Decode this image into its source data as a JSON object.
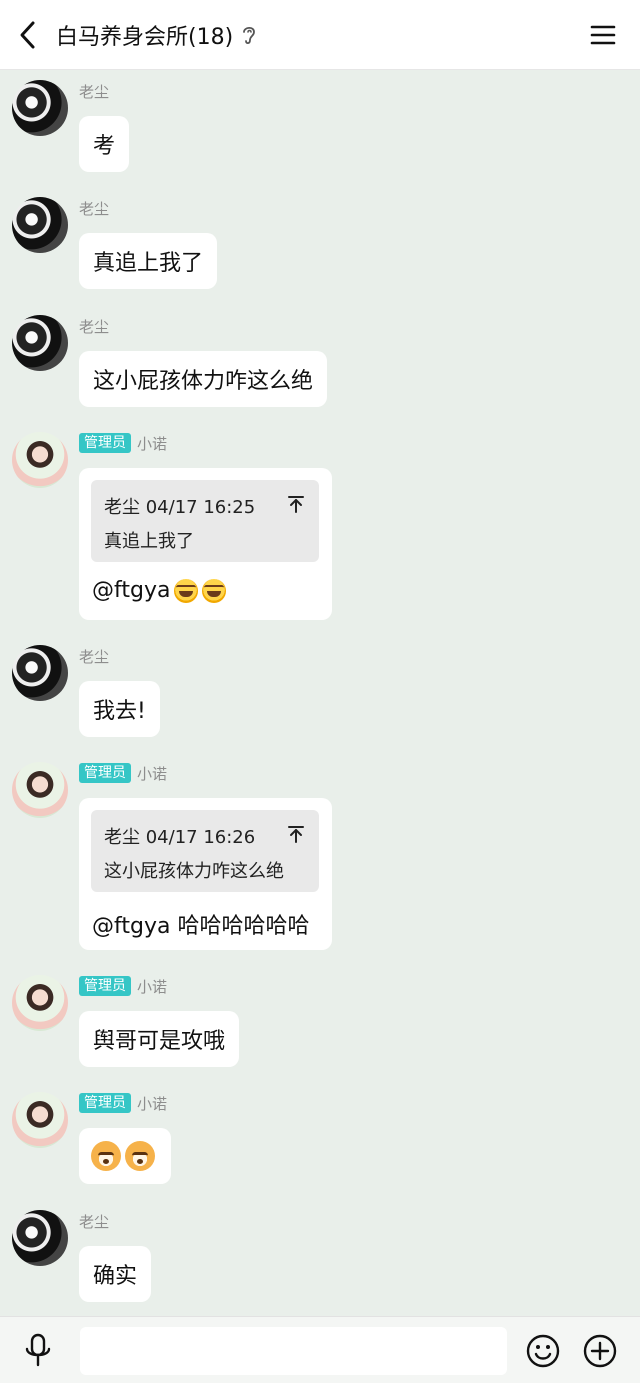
{
  "header": {
    "title": "白马养身会所(18)"
  },
  "messages": [
    {
      "sender": "老尘",
      "admin": false,
      "text": "考"
    },
    {
      "sender": "老尘",
      "admin": false,
      "text": "真追上我了"
    },
    {
      "sender": "老尘",
      "admin": false,
      "text": "这小屁孩体力咋这么绝"
    },
    {
      "sender": "小诺",
      "admin": true,
      "badge": "管理员",
      "quote_head": "老尘 04/17 16:25",
      "quote_text": "真追上我了",
      "reply": "@ftgya"
    },
    {
      "sender": "老尘",
      "admin": false,
      "text": "我去!"
    },
    {
      "sender": "小诺",
      "admin": true,
      "badge": "管理员",
      "quote_head": "老尘 04/17 16:26",
      "quote_text": "这小屁孩体力咋这么绝",
      "reply": "@ftgya 哈哈哈哈哈哈"
    },
    {
      "sender": "小诺",
      "admin": true,
      "badge": "管理员",
      "text": "舆哥可是攻哦"
    },
    {
      "sender": "小诺",
      "admin": true,
      "badge": "管理员",
      "emoji": "doge-emoji"
    },
    {
      "sender": "老尘",
      "admin": false,
      "text": "确实"
    }
  ],
  "input": {
    "placeholder": ""
  },
  "icons": {
    "back": "chevron-left-icon",
    "ear": "ear-icon",
    "menu": "hamburger-menu-icon",
    "mic": "microphone-icon",
    "emoji": "smiley-icon",
    "plus": "plus-circle-icon"
  },
  "colors": {
    "background": "#e9efea",
    "admin_badge": "#35c6c6",
    "bubble": "#ffffff"
  }
}
